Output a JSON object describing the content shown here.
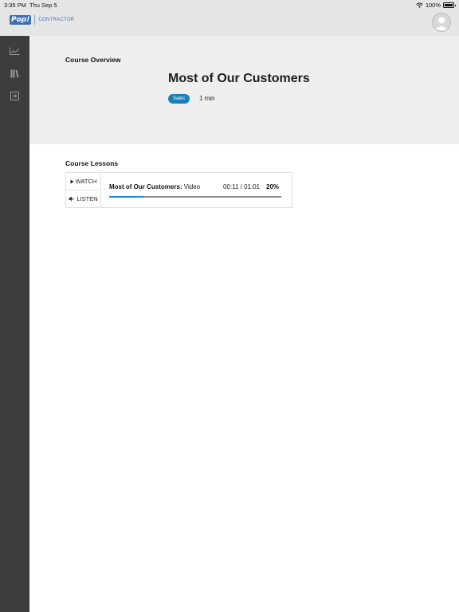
{
  "status_bar": {
    "time": "3:35 PM",
    "date": "Thu Sep 5",
    "battery": "100%"
  },
  "header": {
    "logo_primary": "Pop!",
    "logo_secondary": "CONTRACTOR"
  },
  "sidebar": {
    "items": [
      {
        "icon": "chart-line-icon"
      },
      {
        "icon": "library-icon"
      },
      {
        "icon": "sign-out-icon"
      }
    ]
  },
  "overview": {
    "label": "Course Overview",
    "title": "Most of Our Customers",
    "tag": "Sales",
    "duration": "1 min"
  },
  "lessons": {
    "label": "Course Lessons",
    "items": [
      {
        "watch_label": "WATCH",
        "listen_label": "LISTEN",
        "title": "Most of Our Customers:",
        "type": "Video",
        "time": "00:11 / 01:01",
        "percent_label": "20%",
        "progress": 0.2
      }
    ]
  },
  "colors": {
    "accent": "#1f8ad2",
    "tag": "#1a7fb5",
    "sidebar": "#3d3d3d"
  }
}
